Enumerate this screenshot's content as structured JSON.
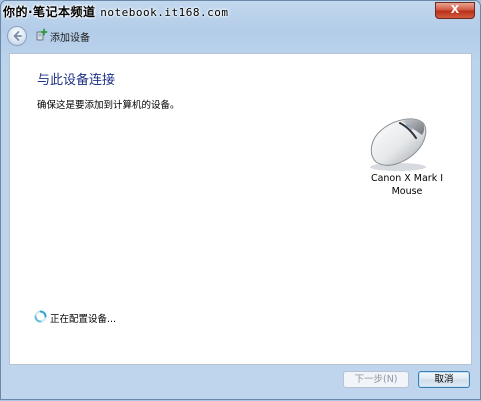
{
  "watermark": {
    "prefix": "你的·笔记本频道",
    "url": "notebook.it168.com"
  },
  "window": {
    "close_label": "X"
  },
  "toolbar": {
    "title": "添加设备"
  },
  "main": {
    "heading": "与此设备连接",
    "subtext": "确保这是要添加到计算机的设备。",
    "device": {
      "line1": "Canon X Mark I",
      "line2": "Mouse",
      "icon": "mouse-icon"
    },
    "status_text": "正在配置设备..."
  },
  "footer": {
    "next_label": "下一步(N)",
    "cancel_label": "取消"
  },
  "colors": {
    "heading": "#1e3287",
    "frame": "#bcd3ec",
    "close": "#c8402a"
  }
}
